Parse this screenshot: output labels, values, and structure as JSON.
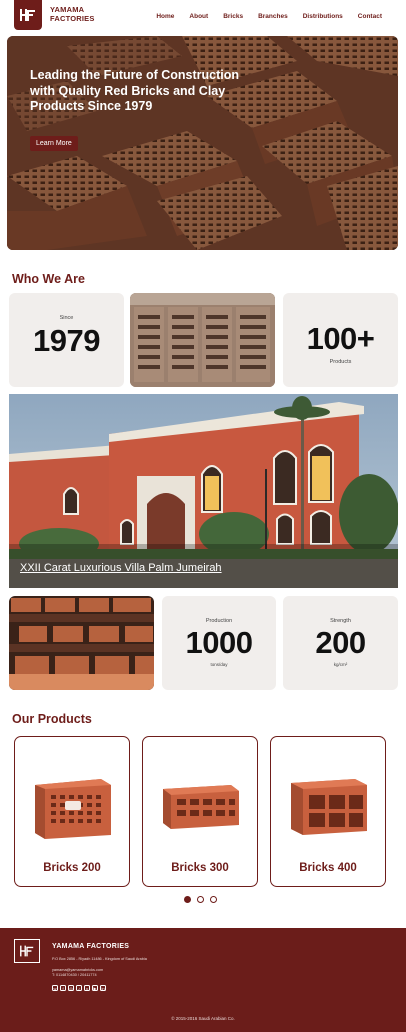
{
  "header": {
    "brand_line1": "YAMAMA",
    "brand_line2": "FACTORIES",
    "nav": [
      "Home",
      "About",
      "Bricks",
      "Branches",
      "Distributions",
      "Contact"
    ]
  },
  "hero": {
    "title": "Leading the Future of Construction with Quality Red Bricks and Clay Products Since 1979",
    "button": "Learn More"
  },
  "who": {
    "title": "Who We Are",
    "since_label": "Since",
    "since_value": "1979",
    "products_value": "100+",
    "products_label": "Products",
    "villa_caption": "XXII Carat Luxurious Villa Palm Jumeirah",
    "production_label": "Production",
    "production_value": "1000",
    "production_unit": "tons/day",
    "strength_label": "Strength",
    "strength_value": "200",
    "strength_unit": "kg/cm²"
  },
  "products": {
    "title": "Our Products",
    "items": [
      "Bricks 200",
      "Bricks 300",
      "Bricks 400"
    ]
  },
  "footer": {
    "brand": "YAMAMA FACTORIES",
    "address": "P.O Box 2856 - Riyadh 11486 - Kingdom of Saudi Arabia",
    "email": "yamama@yamamabricks.com",
    "phone": "T: 0114870430 / 20411774",
    "social": [
      "whatsapp",
      "facebook",
      "instagram",
      "tiktok",
      "x",
      "youtube",
      "linkedin"
    ],
    "copyright": "© 2015-2016 Saudi Arabian Co."
  },
  "colors": {
    "brand": "#6e1d1a",
    "card_bg": "#f1eeec",
    "footer_bg": "#6b1d1a"
  }
}
